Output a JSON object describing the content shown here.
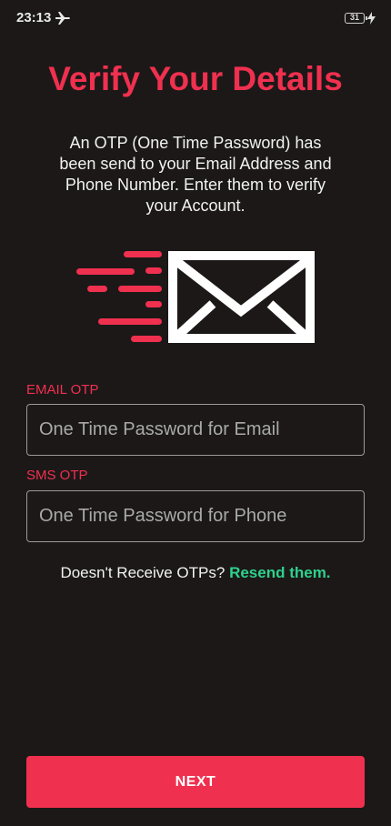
{
  "status_bar": {
    "time": "23:13",
    "battery_level": "31",
    "icons": [
      "airplane-mode-icon",
      "battery-icon",
      "charging-bolt-icon"
    ]
  },
  "header": {
    "title": "Verify Your Details",
    "subtitle": "An OTP (One Time Password) has been send to your Email Address and Phone Number. Enter them to verify your Account."
  },
  "illustration": {
    "icon": "email-sent-envelope-icon"
  },
  "form": {
    "email_label": "EMAIL OTP",
    "email_placeholder": "One Time Password for Email",
    "email_value": "",
    "sms_label": "SMS OTP",
    "sms_placeholder": "One Time Password for Phone",
    "sms_value": ""
  },
  "resend": {
    "prompt": "Doesn't Receive OTPs?",
    "link_label": "Resend them."
  },
  "next_button": {
    "label": "NEXT"
  },
  "colors": {
    "background": "#1c1818",
    "accent": "#f0304f",
    "link": "#2ed18c",
    "text": "#f2f2f2"
  }
}
